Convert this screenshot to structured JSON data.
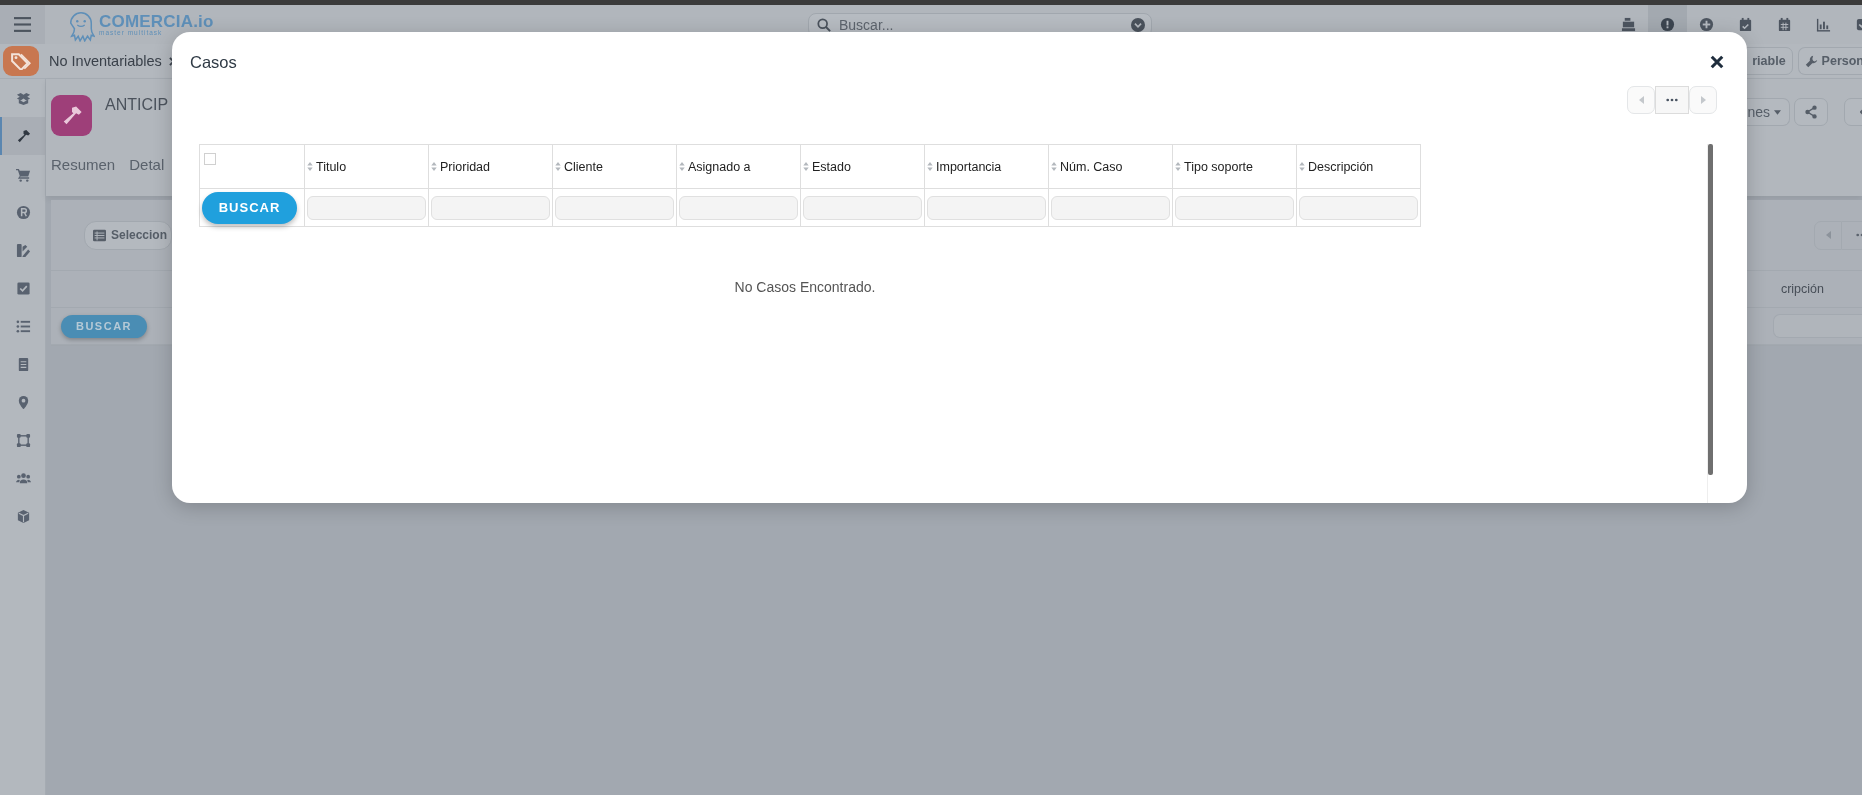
{
  "topbar": {
    "logo": "COMERCIA.io",
    "tagline": "master multitask",
    "search": {
      "placeholder": "Buscar..."
    },
    "icons": [
      {
        "kind": "register",
        "selected": false
      },
      {
        "kind": "alert",
        "selected": true
      },
      {
        "kind": "plus",
        "selected": false
      },
      {
        "kind": "calendar-check",
        "selected": false
      },
      {
        "kind": "calendar",
        "selected": false
      },
      {
        "kind": "chart",
        "selected": false
      },
      {
        "kind": "check-square",
        "selected": false
      }
    ]
  },
  "breadcrumb": {
    "label": "No Inventariables",
    "buttons": [
      {
        "kind": "plain",
        "label": "riable"
      },
      {
        "kind": "wrench",
        "label": "Person"
      }
    ]
  },
  "sidebar": {
    "items": [
      {
        "kind": "boxes",
        "selected": false
      },
      {
        "kind": "hammer",
        "selected": true
      },
      {
        "kind": "cart",
        "selected": false
      },
      {
        "kind": "registered",
        "selected": false
      },
      {
        "kind": "swatches",
        "selected": false
      },
      {
        "kind": "check",
        "selected": false
      },
      {
        "kind": "list",
        "selected": false
      },
      {
        "kind": "cabinet",
        "selected": false
      },
      {
        "kind": "pin",
        "selected": false
      },
      {
        "kind": "vector",
        "selected": false
      },
      {
        "kind": "users",
        "selected": false
      },
      {
        "kind": "cube",
        "selected": false
      }
    ]
  },
  "record": {
    "title": "ANTICIP",
    "tabs": [
      "Resumen",
      "Detal"
    ],
    "menu_button": "nes"
  },
  "list": {
    "select_button": "Seleccion",
    "column": "cripción",
    "search_button": "BUSCAR"
  },
  "modal": {
    "title": "Casos",
    "select_all": {
      "checked": false
    },
    "columns": [
      "Titulo",
      "Prioridad",
      "Cliente",
      "Asignado a",
      "Estado",
      "Importancia",
      "Núm. Caso",
      "Tipo soporte",
      "Descripción"
    ],
    "search_button": "BUSCAR",
    "empty_message": "No Casos Encontrado."
  }
}
